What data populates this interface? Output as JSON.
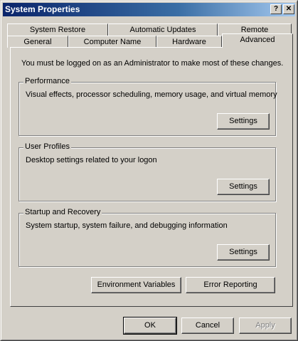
{
  "window": {
    "title": "System Properties",
    "help_glyph": "?",
    "close_glyph": "✕"
  },
  "tabs_back": [
    {
      "label": "System Restore"
    },
    {
      "label": "Automatic Updates"
    },
    {
      "label": "Remote"
    }
  ],
  "tabs_front": [
    {
      "label": "General"
    },
    {
      "label": "Computer Name"
    },
    {
      "label": "Hardware"
    },
    {
      "label": "Advanced"
    }
  ],
  "active_tab": "Advanced",
  "advanced": {
    "intro": "You must be logged on as an Administrator to make most of these changes.",
    "performance": {
      "label": "Performance",
      "description": "Visual effects, processor scheduling, memory usage, and virtual memory",
      "button": "Settings"
    },
    "user_profiles": {
      "label": "User Profiles",
      "description": "Desktop settings related to your logon",
      "button": "Settings"
    },
    "startup_recovery": {
      "label": "Startup and Recovery",
      "description": "System startup, system failure, and debugging information",
      "button": "Settings"
    },
    "environment_variables": "Environment Variables",
    "error_reporting": "Error Reporting"
  },
  "footer": {
    "ok": "OK",
    "cancel": "Cancel",
    "apply": "Apply"
  }
}
